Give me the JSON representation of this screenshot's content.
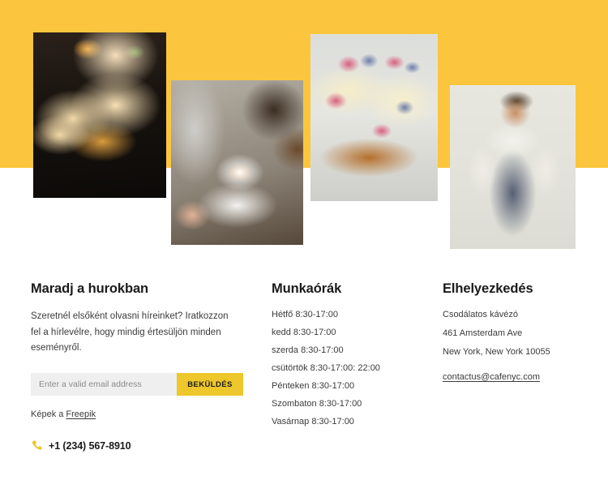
{
  "theme": {
    "band_yellow": "#FBC63D",
    "button_yellow": "#EDC72B",
    "input_gray": "#F0EFEF",
    "text_dark": "#1a1a1a",
    "text_body": "#3b3b3b"
  },
  "hero": {
    "images": [
      {
        "name": "sliced-fruit-loaf-on-dark-board",
        "alt": "Sliced fruit loaf cake on a dark wooden board"
      },
      {
        "name": "hands-holding-espresso-cup",
        "alt": "Hands holding a white cup of espresso on a saucer"
      },
      {
        "name": "cheesecake-slices-with-berries",
        "alt": "Slices of cheesecake topped with raspberries and blueberries"
      },
      {
        "name": "smiling-baker-in-apron",
        "alt": "Smiling baker wearing a denim apron with arms crossed"
      }
    ]
  },
  "newsletter": {
    "title": "Maradj a hurokban",
    "intro": "Szeretnél elsőként olvasni híreinket? Iratkozzon fel a hírlevélre, hogy mindig értesüljön minden eseményről.",
    "email_placeholder": "Enter a valid email address",
    "email_value": "",
    "submit_label": "BEKÜLDÉS",
    "credit_prefix": "Képek a ",
    "credit_link": "Freepik",
    "phone": "+1 (234) 567-8910",
    "phone_icon": "phone-icon"
  },
  "hours": {
    "title": "Munkaórák",
    "items": [
      "Hétfő 8:30-17:00",
      "kedd 8:30-17:00",
      "szerda 8:30-17:00",
      "csütörtök 8:30-17:00: 22:00",
      "Pénteken 8:30-17:00",
      "Szombaton 8:30-17:00",
      "Vasárnap 8:30-17:00"
    ]
  },
  "location": {
    "title": "Elhelyezkedés",
    "lines": [
      "Csodálatos kávézó",
      "461 Amsterdam Ave",
      "New York, New York 10055"
    ],
    "email": "contactus@cafenyc.com"
  }
}
